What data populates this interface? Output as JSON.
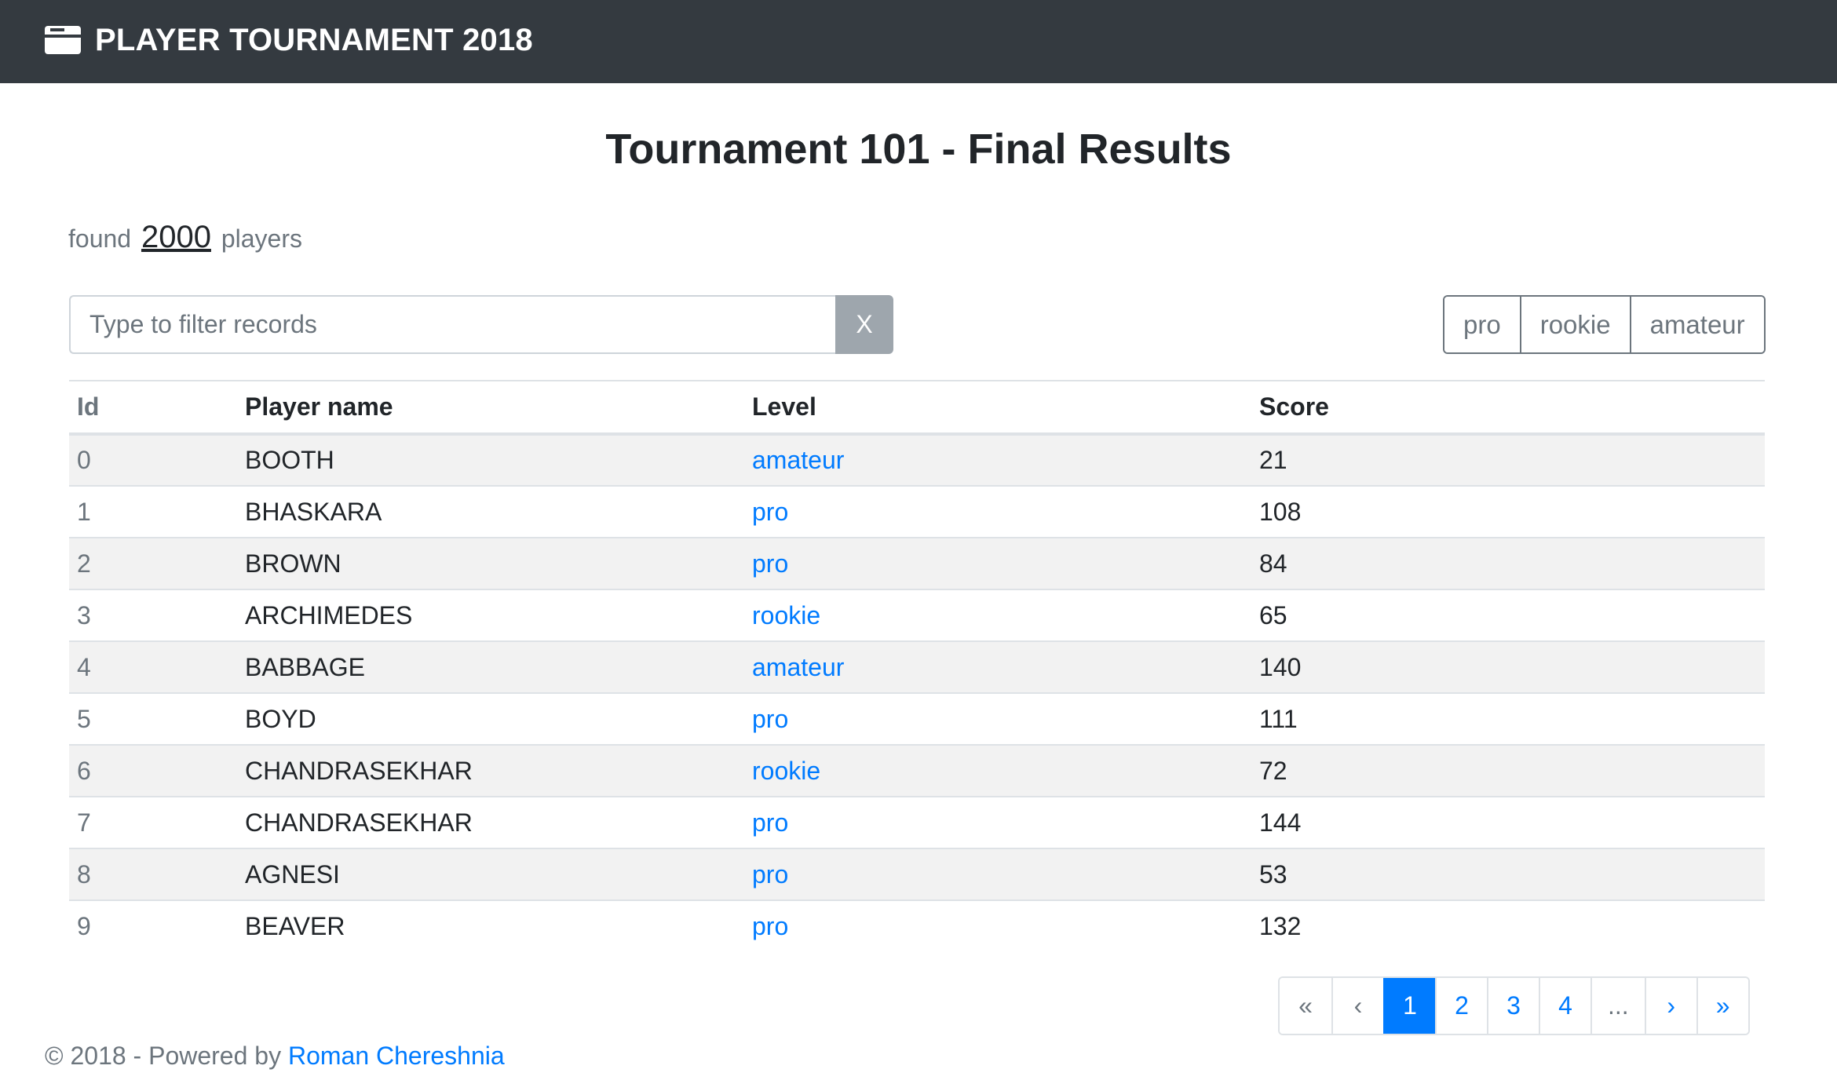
{
  "navbar": {
    "brand_icon": "window-icon",
    "title": "PLAYER TOURNAMENT 2018"
  },
  "page": {
    "title": "Tournament 101 - Final Results"
  },
  "summary": {
    "prefix": "found",
    "count": "2000",
    "suffix": "players"
  },
  "filter": {
    "placeholder": "Type to filter records",
    "value": "",
    "clear_label": "X"
  },
  "level_filters": [
    "pro",
    "rookie",
    "amateur"
  ],
  "table": {
    "headers": {
      "id": "Id",
      "name": "Player name",
      "level": "Level",
      "score": "Score"
    },
    "rows": [
      {
        "id": "0",
        "name": "BOOTH",
        "level": "amateur",
        "score": "21"
      },
      {
        "id": "1",
        "name": "BHASKARA",
        "level": "pro",
        "score": "108"
      },
      {
        "id": "2",
        "name": "BROWN",
        "level": "pro",
        "score": "84"
      },
      {
        "id": "3",
        "name": "ARCHIMEDES",
        "level": "rookie",
        "score": "65"
      },
      {
        "id": "4",
        "name": "BABBAGE",
        "level": "amateur",
        "score": "140"
      },
      {
        "id": "5",
        "name": "BOYD",
        "level": "pro",
        "score": "111"
      },
      {
        "id": "6",
        "name": "CHANDRASEKHAR",
        "level": "rookie",
        "score": "72"
      },
      {
        "id": "7",
        "name": "CHANDRASEKHAR",
        "level": "pro",
        "score": "144"
      },
      {
        "id": "8",
        "name": "AGNESI",
        "level": "pro",
        "score": "53"
      },
      {
        "id": "9",
        "name": "BEAVER",
        "level": "pro",
        "score": "132"
      }
    ]
  },
  "pagination": {
    "first": "«",
    "prev": "‹",
    "pages": [
      "1",
      "2",
      "3",
      "4"
    ],
    "current": "1",
    "ellipsis": "...",
    "next": "›",
    "last": "»"
  },
  "footer": {
    "text": "© 2018 - Powered by",
    "author": "Roman Chereshnia"
  },
  "colors": {
    "navbar": "#343a40",
    "link": "#007bff",
    "muted": "#6c757d",
    "stripe": "#f2f2f2"
  }
}
